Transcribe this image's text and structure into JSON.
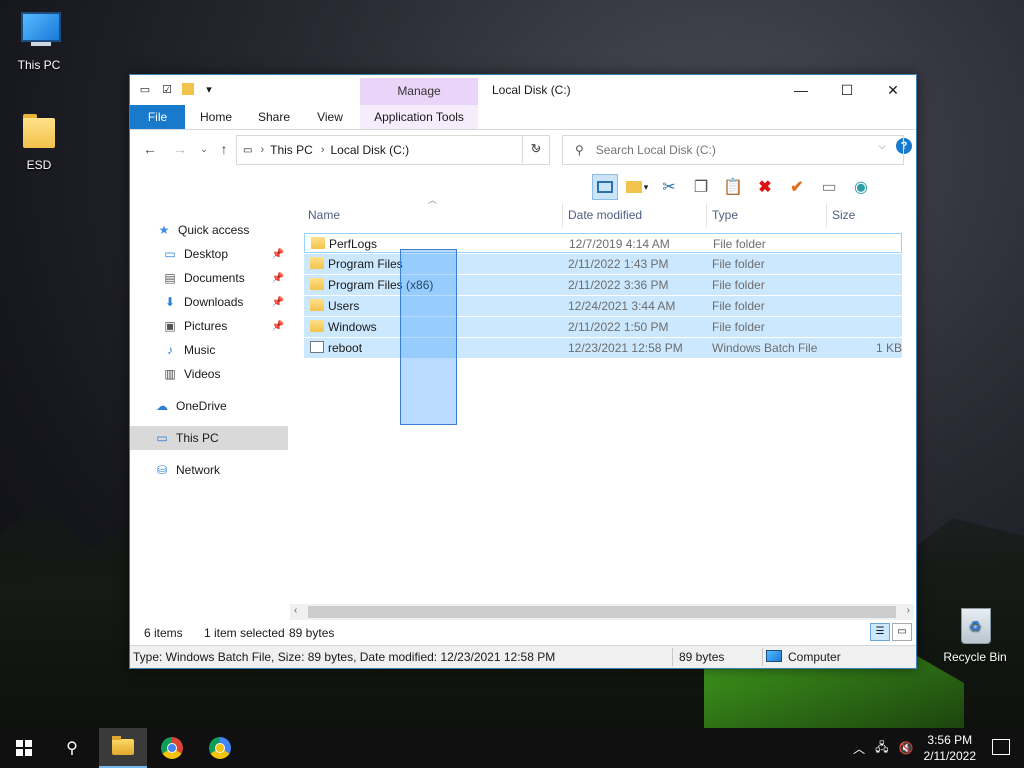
{
  "desktop": {
    "icons": [
      {
        "label": "This PC"
      },
      {
        "label": "ESD"
      },
      {
        "label": "Recycle Bin"
      }
    ]
  },
  "window": {
    "title": "Local Disk (C:)",
    "context_tab_group": "Manage",
    "ribbon_tabs": [
      "File",
      "Home",
      "Share",
      "View",
      "Application Tools"
    ],
    "address": {
      "crumbs": [
        "This PC",
        "Local Disk (C:)"
      ]
    },
    "search": {
      "placeholder": "Search Local Disk (C:)"
    },
    "nav": {
      "quick_access": "Quick access",
      "desktop": "Desktop",
      "documents": "Documents",
      "downloads": "Downloads",
      "pictures": "Pictures",
      "music": "Music",
      "videos": "Videos",
      "onedrive": "OneDrive",
      "this_pc": "This PC",
      "network": "Network"
    },
    "columns": {
      "name": "Name",
      "date": "Date modified",
      "type": "Type",
      "size": "Size"
    },
    "files": [
      {
        "name": "PerfLogs",
        "date": "12/7/2019 4:14 AM",
        "type": "File folder",
        "size": ""
      },
      {
        "name": "Program Files",
        "date": "2/11/2022 1:43 PM",
        "type": "File folder",
        "size": ""
      },
      {
        "name": "Program Files (x86)",
        "date": "2/11/2022 3:36 PM",
        "type": "File folder",
        "size": ""
      },
      {
        "name": "Users",
        "date": "12/24/2021 3:44 AM",
        "type": "File folder",
        "size": ""
      },
      {
        "name": "Windows",
        "date": "2/11/2022 1:50 PM",
        "type": "File folder",
        "size": ""
      },
      {
        "name": "reboot",
        "date": "12/23/2021 12:58 PM",
        "type": "Windows Batch File",
        "size": "1 KB"
      }
    ],
    "status": {
      "items": "6 items",
      "selected": "1 item selected",
      "bytes": "89 bytes"
    },
    "details": {
      "text": "Type: Windows Batch File, Size: 89 bytes, Date modified: 12/23/2021 12:58 PM",
      "size": "89 bytes",
      "zone": "Computer"
    }
  },
  "taskbar": {
    "time": "3:56 PM",
    "date": "2/11/2022"
  }
}
